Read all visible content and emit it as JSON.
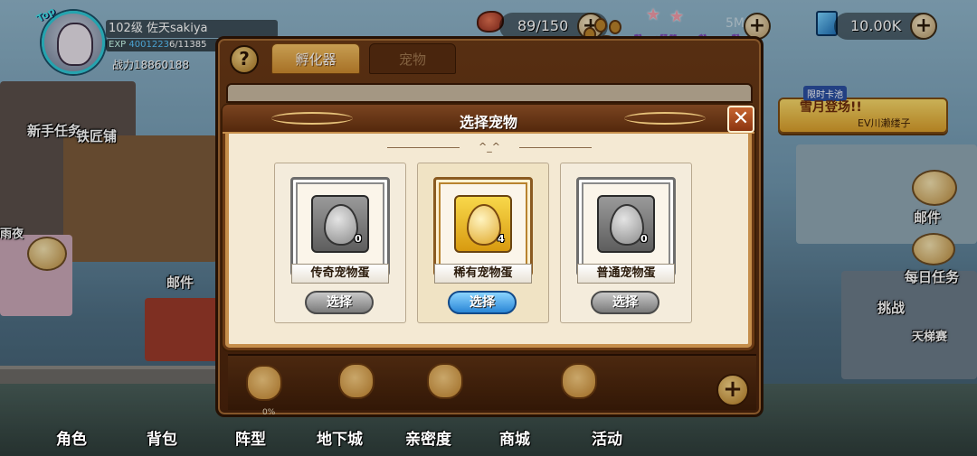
{
  "player": {
    "level_name": "102级  佐天sakiya",
    "exp_label": "EXP",
    "exp_value": "4001223",
    "exp_rest": "6/11385",
    "power": "战力18860188",
    "top_tag": "Top"
  },
  "resources": {
    "stamina": "89/150",
    "gems": "10.00K",
    "hidden_value": "5M"
  },
  "logo": {
    "title": "宠物之家"
  },
  "event": {
    "tag": "限时卡池",
    "title": "雪月登场!!",
    "subtitle": "EV川濑缕子"
  },
  "scene_labels": {
    "newbie_task": "新手任务",
    "blacksmith": "铁匠铺",
    "rain_night": "雨夜",
    "mail_left": "邮件",
    "mail_right": "邮件",
    "daily_task": "每日任务",
    "challenge": "挑战",
    "ladder": "天梯赛"
  },
  "panel": {
    "help": "?",
    "tabs": [
      {
        "label": "孵化器"
      },
      {
        "label": "宠物"
      }
    ],
    "progress": "0%",
    "add": "+"
  },
  "modal": {
    "title": "选择宠物",
    "close": "✕",
    "decoration": "^_^",
    "eggs": [
      {
        "name": "传奇宠物蛋",
        "count": "0",
        "button": "选择",
        "selected": false
      },
      {
        "name": "稀有宠物蛋",
        "count": "4",
        "button": "选择",
        "selected": true
      },
      {
        "name": "普通宠物蛋",
        "count": "0",
        "button": "选择",
        "selected": false
      }
    ]
  },
  "bottom_nav": [
    {
      "label": "角色"
    },
    {
      "label": "背包"
    },
    {
      "label": "阵型"
    },
    {
      "label": "地下城"
    },
    {
      "label": "亲密度"
    },
    {
      "label": "商城"
    },
    {
      "label": "活动"
    }
  ]
}
